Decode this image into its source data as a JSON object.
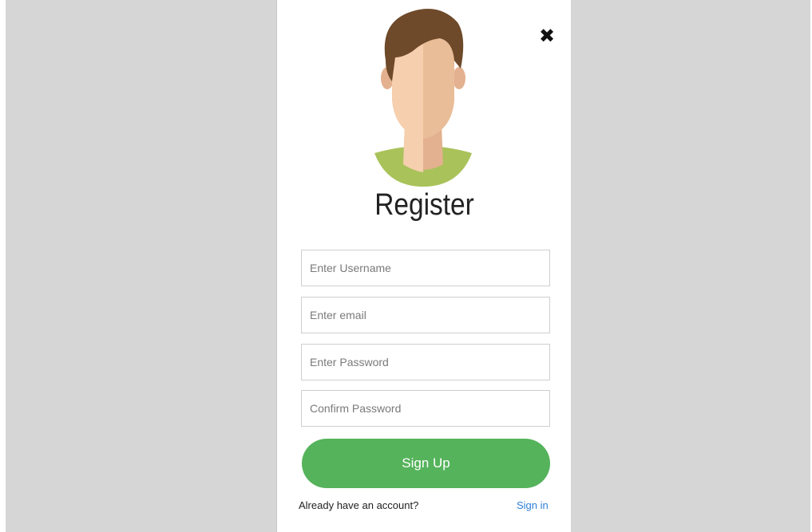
{
  "modal": {
    "close_label": "✖",
    "title": "Register",
    "fields": {
      "username_placeholder": "Enter Username",
      "email_placeholder": "Enter email",
      "password_placeholder": "Enter Password",
      "confirm_placeholder": "Confirm Password"
    },
    "signup_label": "Sign Up",
    "footer_text": "Already have an account?",
    "signin_label": "Sign in"
  },
  "icons": {
    "avatar": "user-avatar-illustration",
    "close": "close-icon"
  },
  "colors": {
    "background": "#d6d6d6",
    "button": "#55b35b",
    "link": "#2f7fd6",
    "shirt": "#a9c25a",
    "hair": "#6e4a2a",
    "skin_light": "#f5cfae",
    "skin_dark": "#e3b18f"
  }
}
